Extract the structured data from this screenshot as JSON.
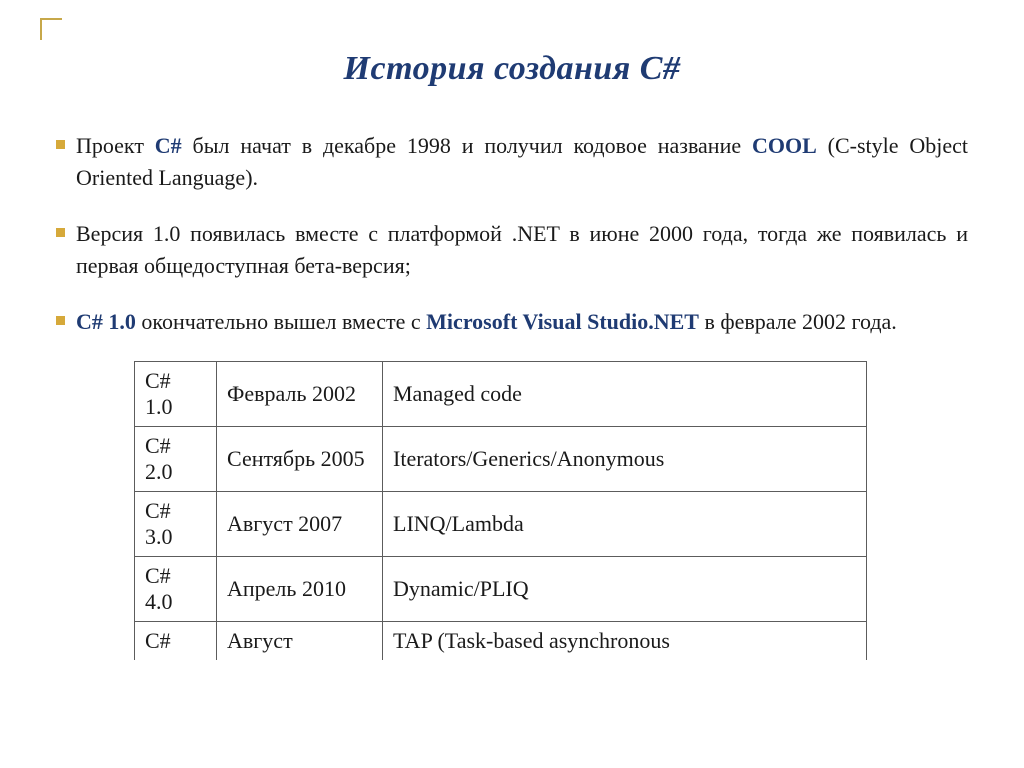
{
  "title": "История создания С#",
  "bullets": [
    {
      "segments": [
        {
          "t": "Проект ",
          "hl": false
        },
        {
          "t": "C#",
          "hl": true
        },
        {
          "t": " был начат в декабре 1998 и получил кодовое название ",
          "hl": false
        },
        {
          "t": "COOL",
          "hl": true
        },
        {
          "t": " (C-style Object Oriented Language).",
          "hl": false
        }
      ]
    },
    {
      "segments": [
        {
          "t": "Версия 1.0 появилась вместе с платформой .NET в июне 2000 года, тогда же появилась и первая общедоступная бета-версия;",
          "hl": false
        }
      ]
    },
    {
      "segments": [
        {
          "t": "C# 1.0",
          "hl": true
        },
        {
          "t": " окончательно вышел вместе с ",
          "hl": false
        },
        {
          "t": "Microsoft Visual Studio.NET",
          "hl": true
        },
        {
          "t": " в феврале 2002 года.",
          "hl": false
        }
      ]
    }
  ],
  "table": {
    "rows": [
      {
        "version": "C# 1.0",
        "date": "Февраль 2002",
        "features": "Managed code",
        "clipped": false
      },
      {
        "version": "C# 2.0",
        "date": "Сентябрь 2005",
        "features": "Iterators/Generics/Anonymous",
        "clipped": false
      },
      {
        "version": "C# 3.0",
        "date": "Август 2007",
        "features": "LINQ/Lambda",
        "clipped": false
      },
      {
        "version": "C# 4.0",
        "date": "Апрель 2010",
        "features": "Dynamic/PLIQ",
        "clipped": false
      },
      {
        "version": "C#",
        "date": "Август",
        "features": "TAP (Task-based asynchronous",
        "clipped": true
      }
    ]
  }
}
